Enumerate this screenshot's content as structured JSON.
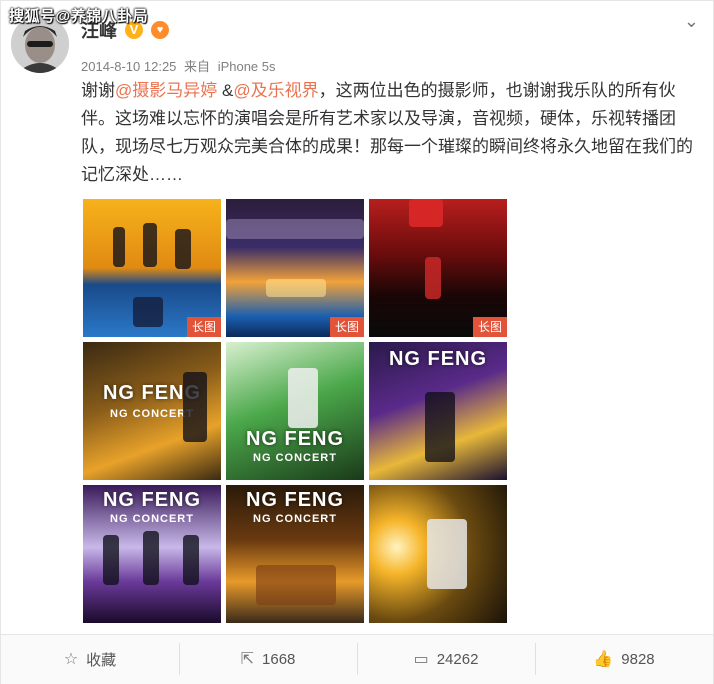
{
  "watermark": "搜狐号@养锦八卦局",
  "post": {
    "author": "汪峰",
    "verified_icon": "verified-v-icon",
    "fan_badge_icon": "heart-badge-icon",
    "timestamp": "2014-8-10 12:25",
    "source_prefix": "来自",
    "source": "iPhone 5s",
    "text_part1": "谢谢",
    "mention1": "@摄影马异婷",
    "text_part2": " &",
    "mention2": "@及乐视界",
    "text_part3": "，这两位出色的摄影师，也谢谢我乐队的所有伙伴。这场难以忘怀的演唱会是所有艺术家以及导演，音视频，硬体，乐视转播团队，现场尽七万观众完美合体的成果！那每一个璀璨的瞬间终将永久地留在我们的记忆深处……"
  },
  "images": [
    {
      "long_tag": "长图",
      "banner": "",
      "banner2": ""
    },
    {
      "long_tag": "长图",
      "banner": "",
      "banner2": ""
    },
    {
      "long_tag": "长图",
      "banner": "",
      "banner2": ""
    },
    {
      "long_tag": "",
      "banner": "NG FENG",
      "banner2": "NG CONCERT"
    },
    {
      "long_tag": "",
      "banner": "NG FENG",
      "banner2": "NG CONCERT"
    },
    {
      "long_tag": "",
      "banner": "NG FENG",
      "banner2": ""
    },
    {
      "long_tag": "",
      "banner": "NG FENG",
      "banner2": "NG CONCERT"
    },
    {
      "long_tag": "",
      "banner": "NG FENG",
      "banner2": "NG CONCERT"
    },
    {
      "long_tag": "",
      "banner": "",
      "banner2": ""
    }
  ],
  "actions": {
    "favorite": {
      "label": "收藏",
      "icon": "star-icon"
    },
    "repost": {
      "label": "1668",
      "icon": "share-icon"
    },
    "comment": {
      "label": "24262",
      "icon": "comment-icon"
    },
    "like": {
      "label": "9828",
      "icon": "thumbs-up-icon"
    }
  },
  "colors": {
    "mention": "#eb7350",
    "long_tag": "#e2543a",
    "verified": "#ffb11a"
  }
}
